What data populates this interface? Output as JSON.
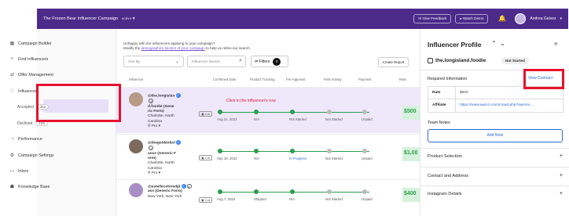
{
  "topbar": {
    "campaign": "The Frozen Bear Influencer Campaign",
    "campaign_status": "active",
    "give_feedback": "Give Feedback",
    "watch_demo": "Watch Demo",
    "user": "Andrea Galvez"
  },
  "sidebar": {
    "items": [
      {
        "label": "Campaign Builder",
        "icon": "builder-icon"
      },
      {
        "label": "Find Influencers",
        "icon": "search-icon"
      },
      {
        "label": "Offer Management",
        "icon": "offer-icon"
      },
      {
        "label": "Influencers",
        "icon": "heart-icon"
      },
      {
        "label": "Performance",
        "icon": "performance-icon"
      },
      {
        "label": "Campaign Settings",
        "icon": "gear-icon"
      },
      {
        "label": "Inbox",
        "icon": "inbox-icon"
      },
      {
        "label": "Knowledge Base",
        "icon": "book-icon"
      }
    ],
    "sub": [
      {
        "label": "Accepted",
        "count": "252"
      },
      {
        "label": "Declined",
        "count": "125"
      }
    ]
  },
  "main": {
    "hint_line1": "Unhappy with the influencers applying to your campaign?",
    "hint_prefix": "Modify the",
    "hint_link": "demographics section of your campaign",
    "hint_suffix": "to help us refine our search.",
    "sort_placeholder": "Sort By",
    "search_placeholder": "Influencer Search",
    "filters_label": "Filters",
    "filters_count": "0",
    "create_report": "Create Report",
    "columns": [
      "Influencer",
      "Confirmed Date",
      "Product Tracking",
      "Pre-Approval",
      "Post Activity",
      "Payment",
      "Rate"
    ],
    "click_hint": "Click in the influencer's row",
    "rows": [
      {
        "name": [
          "@the.longislan",
          "d.foodie (Gene",
          "ric Form)"
        ],
        "location": [
          "Charlotte, North",
          "Carolina"
        ],
        "pro": "Pro",
        "tag": "Cut",
        "date": "Aug 31, 2023",
        "tracking": "N/A",
        "pre": "Not Started",
        "post": "Not Started",
        "payment": "Unpaid",
        "rate": "$500"
      },
      {
        "name": [
          "@thegoldenbol",
          "ance (Generic F",
          "orm)"
        ],
        "location": [
          "Charlotte, North",
          "Carolina"
        ],
        "pro": "Pro",
        "tag": "Cut",
        "date": "Sep 18, 2023",
        "tracking": "N/A",
        "pre": "In Progress",
        "post": "Not Started",
        "payment": "Unpaid",
        "rate": "$1,00"
      },
      {
        "name": [
          "@estellecoloredgl",
          "ass (Generic Form)"
        ],
        "location": [
          "New York, New York"
        ],
        "pro": "",
        "tag": "Cut",
        "date": "Aug 7, 2023",
        "tracking": "Shipped",
        "pre": "N/A",
        "post": "Not Started",
        "payment": "Unpaid",
        "rate": "$400"
      }
    ]
  },
  "panel": {
    "title": "Influencer Profile",
    "handle": "the.longisland.foodie",
    "status": "Not Started",
    "required_info": "Required Information",
    "view_contract": "View Contract",
    "rate_label": "Rate",
    "rate_value": "$500",
    "affiliate_label": "Affiliate",
    "affiliate_value": "https://www.awin1.com/cread.php?awinmi...",
    "team_notes": "Team Notes",
    "add_note": "Add Note",
    "sections": [
      "Product Selection",
      "Contact and Address",
      "Instagram Details"
    ]
  }
}
